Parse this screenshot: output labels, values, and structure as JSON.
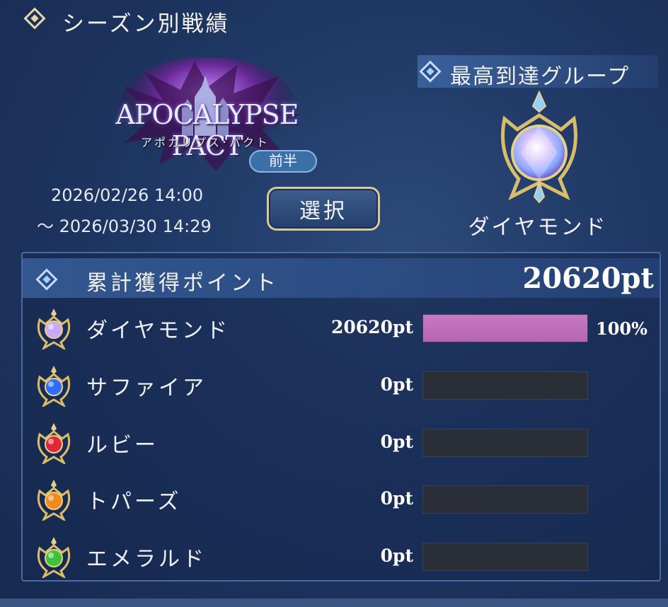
{
  "header": {
    "title": "シーズン別戦績"
  },
  "season": {
    "logo_text": "APOCALYPSE PACT",
    "logo_subtitle": "アポカリプス･パクト",
    "half_label": "前半",
    "start": "2026/02/26 14:00",
    "end": "～ 2026/03/30 14:29",
    "select_label": "選択"
  },
  "highest_group": {
    "label": "最高到達グループ",
    "name": "ダイヤモンド",
    "icon": "diamond-emblem-icon"
  },
  "points": {
    "label": "累計獲得ポイント",
    "total": "20620pt",
    "rows": [
      {
        "name": "ダイヤモンド",
        "points": "20620pt",
        "progress": 1.0,
        "percent": "100%",
        "gem_color": "#c9a8ff",
        "icon": "diamond-emblem-icon"
      },
      {
        "name": "サファイア",
        "points": "0pt",
        "progress": 0,
        "percent": "",
        "gem_color": "#2f6bff",
        "icon": "sapphire-emblem-icon"
      },
      {
        "name": "ルビー",
        "points": "0pt",
        "progress": 0,
        "percent": "",
        "gem_color": "#e0283a",
        "icon": "ruby-emblem-icon"
      },
      {
        "name": "トパーズ",
        "points": "0pt",
        "progress": 0,
        "percent": "",
        "gem_color": "#f08a1c",
        "icon": "topaz-emblem-icon"
      },
      {
        "name": "エメラルド",
        "points": "0pt",
        "progress": 0,
        "percent": "",
        "gem_color": "#3fc23a",
        "icon": "emerald-emblem-icon"
      }
    ]
  },
  "colors": {
    "progress_fill": "#c879c4",
    "gold": "#d9c89a"
  }
}
